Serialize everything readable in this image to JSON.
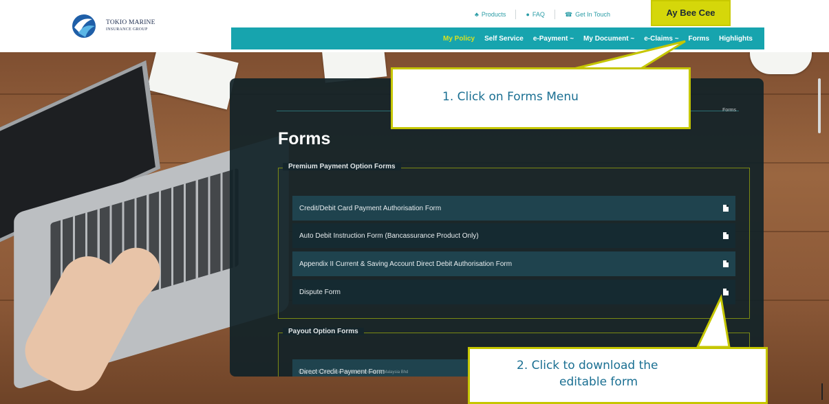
{
  "header": {
    "logo": {
      "line1": "TOKIO MARINE",
      "line2": "INSURANCE GROUP"
    },
    "utility_links": [
      {
        "label": "Products",
        "icon": "products-icon"
      },
      {
        "label": "FAQ",
        "icon": "chat-icon"
      },
      {
        "label": "Get In Touch",
        "icon": "phone-icon"
      }
    ],
    "user_name": "Ay Bee Cee"
  },
  "nav": {
    "items": [
      {
        "label": "My Policy"
      },
      {
        "label": "Self Service"
      },
      {
        "label": "e-Payment ~"
      },
      {
        "label": "My Document ~"
      },
      {
        "label": "e-Claims ~"
      },
      {
        "label": "Forms"
      },
      {
        "label": "Highlights"
      }
    ]
  },
  "page": {
    "breadcrumb": "Forms",
    "title": "Forms",
    "groups": [
      {
        "legend": "Premium Payment Option Forms",
        "forms": [
          "Credit/Debit Card Payment Authorisation Form",
          "Auto Debit Instruction Form (Bancassurance Product Only)",
          "Appendix II Current & Saving Account Direct Debit Authorisation Form",
          "Dispute Form"
        ]
      },
      {
        "legend": "Payout Option Forms",
        "forms": [
          "Direct Credit Payment Form"
        ]
      }
    ],
    "footer": "Copyright © 2018 Tokio Marine Life Insurance Malaysia Bhd"
  },
  "callouts": {
    "step1": "1.   Click on Forms Menu",
    "step2_line1": "2.   Click to download the",
    "step2_line2": "editable form"
  },
  "colors": {
    "nav_bg": "#17a4ae",
    "nav_active": "#d9e21f",
    "user_box": "#d5d70a",
    "panel_bg": "#122228",
    "callout_text": "#1a6f92"
  }
}
